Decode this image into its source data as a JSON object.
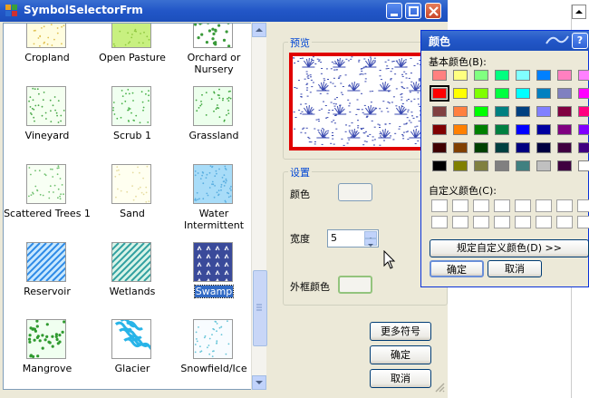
{
  "window": {
    "title": "SymbolSelectorFrm"
  },
  "symbols": [
    {
      "label": "Cropland",
      "fill": "#fffde0",
      "mark": "#e0c050"
    },
    {
      "label": "Open Pasture",
      "fill": "#c8f080",
      "mark": "#90c840"
    },
    {
      "label": "Orchard or Nursery",
      "fill": "#ffffff",
      "mark": "#3a9a3a"
    },
    {
      "label": "Vineyard",
      "fill": "#f4fff0",
      "mark": "#4aa84a"
    },
    {
      "label": "Scrub 1",
      "fill": "#f0fff0",
      "mark": "#48b048"
    },
    {
      "label": "Grassland",
      "fill": "#ecffec",
      "mark": "#40a840"
    },
    {
      "label": "Scattered Trees 1",
      "fill": "#f8fff4",
      "mark": "#70c070"
    },
    {
      "label": "Sand",
      "fill": "#fffff0",
      "mark": "#e6dca0"
    },
    {
      "label": "Water Intermittent",
      "fill": "#a8dcf8",
      "mark": "#5aaee0"
    },
    {
      "label": "Reservoir",
      "fill": "#c8e8ff",
      "mark": "#2d8ae6"
    },
    {
      "label": "Wetlands",
      "fill": "#d8f4e8",
      "mark": "#30a0a0"
    },
    {
      "label": "Swamp",
      "fill": "#3a4a9a",
      "mark": "#ffffff"
    },
    {
      "label": "Mangrove",
      "fill": "#f0fff0",
      "mark": "#2f9a2f"
    },
    {
      "label": "Glacier",
      "fill": "#ffffff",
      "mark": "#28b4e8"
    },
    {
      "label": "Snowfield/Ice",
      "fill": "#f8fcff",
      "mark": "#64c4d8"
    }
  ],
  "selected_symbol": "Swamp",
  "preview": {
    "label": "预览",
    "border_color": "#e00000"
  },
  "settings": {
    "label": "设置",
    "color_label": "颜色",
    "width_label": "宽度",
    "width_value": "5",
    "outline_color_label": "外框颜色"
  },
  "buttons": {
    "more_symbols": "更多符号",
    "ok": "确定",
    "cancel": "取消"
  },
  "color_dialog": {
    "title": "颜色",
    "help": "?",
    "basic_colors_label": "基本颜色(B):",
    "custom_colors_label": "自定义颜色(C):",
    "define_custom": "规定自定义颜色(D) >>",
    "ok": "确定",
    "cancel": "取消",
    "basic_colors": [
      [
        "#ff8080",
        "#ffff80",
        "#80ff80",
        "#00ff80",
        "#80ffff",
        "#0080ff",
        "#ff80c0",
        "#ff80ff"
      ],
      [
        "#ff0000",
        "#ffff00",
        "#80ff00",
        "#00ff40",
        "#00ffff",
        "#0080c0",
        "#8080c0",
        "#ff00ff"
      ],
      [
        "#804040",
        "#ff8040",
        "#00ff00",
        "#008080",
        "#004080",
        "#8080ff",
        "#800040",
        "#ff0080"
      ],
      [
        "#800000",
        "#ff8000",
        "#008000",
        "#008040",
        "#0000ff",
        "#0000a0",
        "#800080",
        "#8000ff"
      ],
      [
        "#400000",
        "#804000",
        "#004000",
        "#004040",
        "#000080",
        "#000040",
        "#400040",
        "#400080"
      ],
      [
        "#000000",
        "#808000",
        "#808040",
        "#808080",
        "#408080",
        "#c0c0c0",
        "#400040",
        "#ffffff"
      ]
    ],
    "selected_cell": [
      1,
      0
    ]
  }
}
